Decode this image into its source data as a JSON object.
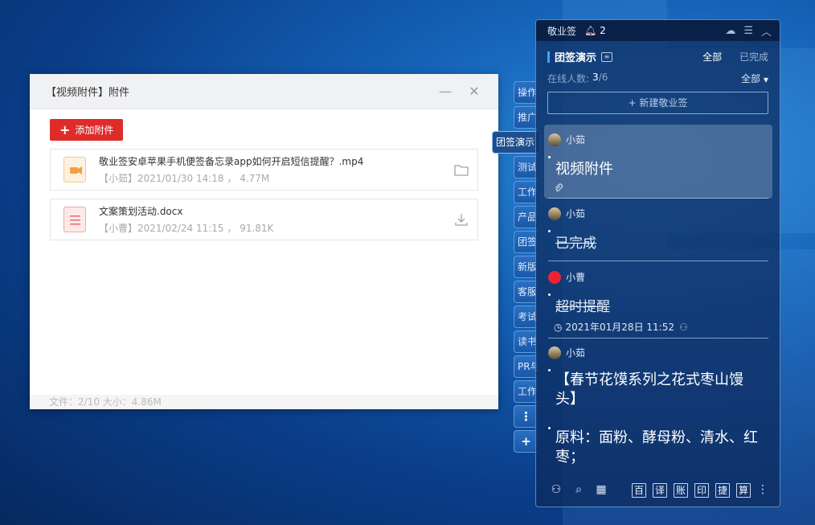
{
  "dialog": {
    "title": "【视频附件】附件",
    "add_button": "添加附件",
    "files": [
      {
        "name": "敬业签安卓苹果手机便签备忘录app如何开启短信提醒？.mp4",
        "meta": "【小茹】2021/01/30 14:18 ， 4.77M",
        "type": "video",
        "action": "folder"
      },
      {
        "name": "文案策划活动.docx",
        "meta": "【小曹】2021/02/24 11:15 ， 91.81K",
        "type": "doc",
        "action": "download"
      }
    ],
    "footer": "文件：2/10    大小：4.86M"
  },
  "side_tabs": [
    "操作",
    "推广",
    "团签演示",
    "测试",
    "工作",
    "产品",
    "团签",
    "新版",
    "客服",
    "考试",
    "读书",
    "PR与",
    "工作"
  ],
  "side_tab_icons": [
    "⋮",
    "+"
  ],
  "panel": {
    "app_name": "敬业签",
    "bell_count": "2",
    "group_name": "团签演示",
    "filter_all": "全部",
    "filter_done": "已完成",
    "online_label": "在线人数:",
    "online_count": "3",
    "online_total": "/6",
    "online_filter": "全部",
    "new_note": "+ 新建敬业签",
    "notes": [
      {
        "user": "小茹",
        "title": "视频附件"
      },
      {
        "user": "小茹",
        "title": "已完成"
      },
      {
        "user": "小曹",
        "title": "超时提醒",
        "time": "2021年01月28日 11:52"
      },
      {
        "user": "小茹",
        "title_line1": "【春节花馍系列之花式枣山馒头】",
        "title_line2": "原料：面粉、酵母粉、清水、红枣；"
      }
    ],
    "bottom_chars": [
      "百",
      "译",
      "账",
      "印",
      "捷",
      "算"
    ]
  }
}
